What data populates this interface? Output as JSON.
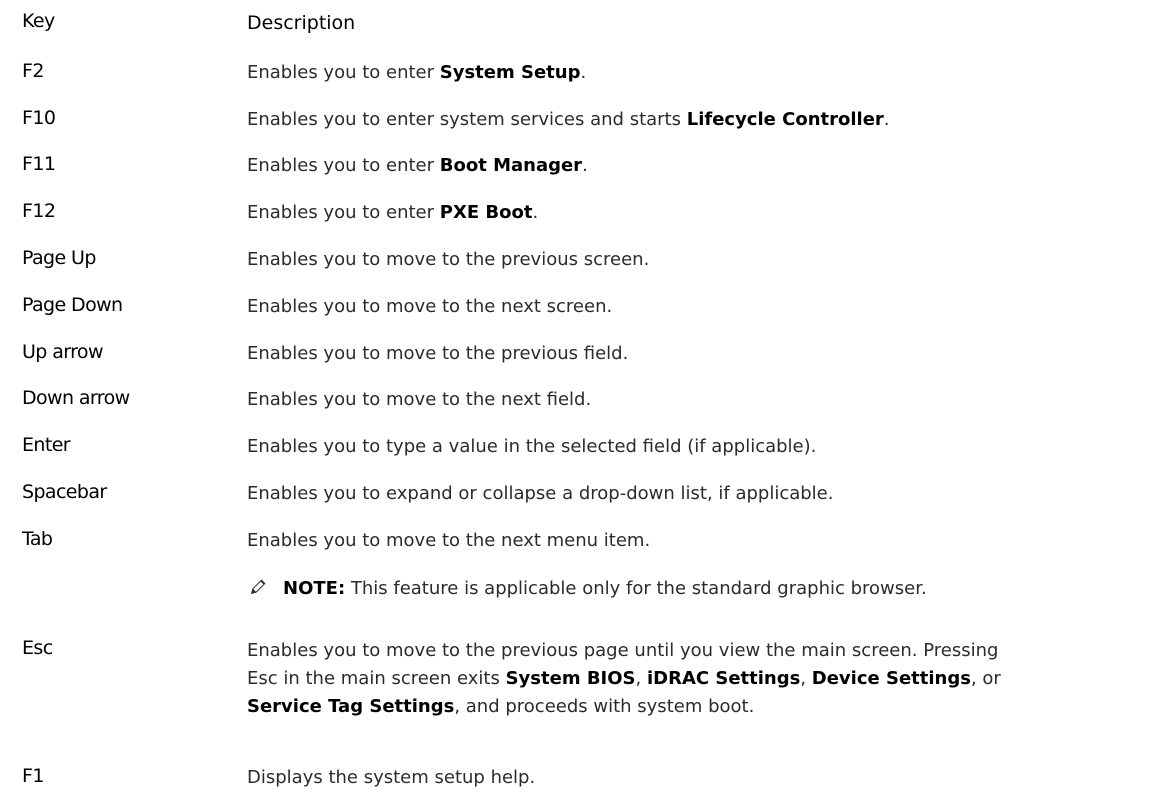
{
  "header": {
    "key": "Key",
    "description": "Description"
  },
  "rows": [
    {
      "key": "F2",
      "pre": "Enables you to enter ",
      "bold": "System Setup",
      "post": "."
    },
    {
      "key": "F10",
      "pre": "Enables you to enter system services and starts ",
      "bold": "Lifecycle Controller",
      "post": "."
    },
    {
      "key": "F11",
      "pre": "Enables you to enter ",
      "bold": "Boot Manager",
      "post": "."
    },
    {
      "key": "F12",
      "pre": "Enables you to enter ",
      "bold": "PXE Boot",
      "post": "."
    },
    {
      "key": "Page Up",
      "text": "Enables you to move to the previous screen."
    },
    {
      "key": "Page Down",
      "text": "Enables you to move to the next screen."
    },
    {
      "key": "Up arrow",
      "text": "Enables you to move to the previous field."
    },
    {
      "key": "Down arrow",
      "text": "Enables you to move to the next field."
    },
    {
      "key": "Enter",
      "text": "Enables you to type a value in the selected field (if applicable)."
    },
    {
      "key": "Spacebar",
      "text": "Enables you to expand or collapse a drop-down list, if applicable."
    },
    {
      "key": "Tab",
      "text": "Enables you to move to the next menu item."
    }
  ],
  "note": {
    "icon": "pencil-note-icon",
    "label": "NOTE:",
    "text": " This feature is applicable only for the standard graphic browser."
  },
  "esc": {
    "key": "Esc",
    "line1": "Enables you to move to the previous page until you view the main screen. Pressing",
    "line2_pre": "Esc in the main screen exits ",
    "b1": "System BIOS",
    "sep1": ", ",
    "b2": "iDRAC Settings",
    "sep2": ", ",
    "b3": "Device Settings",
    "sep3": ", or",
    "b4": "Service Tag Settings",
    "line3_post": ", and proceeds with system boot."
  },
  "f1": {
    "key": "F1",
    "text": "Displays the system setup help."
  }
}
